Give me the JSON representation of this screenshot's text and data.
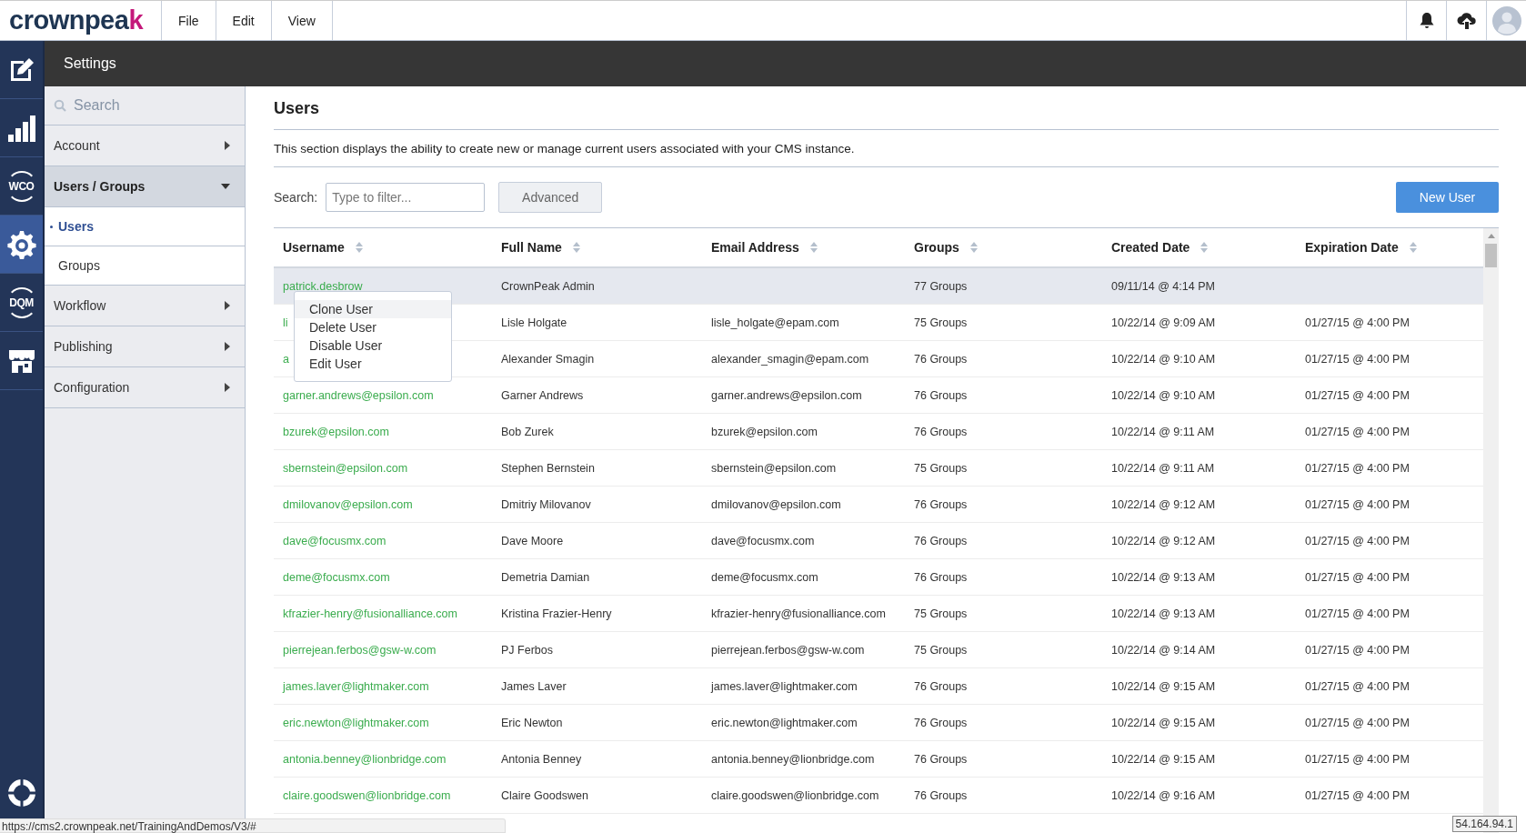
{
  "app": {
    "logo": "crownpea",
    "logo_accent": "k",
    "menu": [
      "File",
      "Edit",
      "View"
    ]
  },
  "rail": [
    {
      "kind": "edit",
      "selected": false
    },
    {
      "kind": "chart",
      "selected": false
    },
    {
      "kind": "badge",
      "label": "WCO",
      "selected": false
    },
    {
      "kind": "settings",
      "selected": true
    },
    {
      "kind": "badge",
      "label": "DQM",
      "selected": false
    },
    {
      "kind": "store",
      "selected": false
    },
    {
      "kind": "help",
      "selected": false
    }
  ],
  "header": {
    "title": "Settings"
  },
  "nav": {
    "search_placeholder": "Search",
    "items": [
      {
        "label": "Account",
        "expanded": false
      },
      {
        "label": "Users / Groups",
        "expanded": true,
        "children": [
          {
            "label": "Users",
            "selected": true
          },
          {
            "label": "Groups",
            "selected": false
          }
        ]
      },
      {
        "label": "Workflow",
        "expanded": false
      },
      {
        "label": "Publishing",
        "expanded": false
      },
      {
        "label": "Configuration",
        "expanded": false
      }
    ]
  },
  "content": {
    "title": "Users",
    "description": "This section displays the ability to create new or manage current users associated with your CMS instance.",
    "search_label": "Search:",
    "search_placeholder": "Type to filter...",
    "advanced_button": "Advanced",
    "new_button": "New User"
  },
  "table": {
    "columns": [
      "Username",
      "Full Name",
      "Email Address",
      "Groups",
      "Created Date",
      "Expiration Date"
    ],
    "rows": [
      {
        "selected": true,
        "cells": [
          "patrick.desbrow",
          "CrownPeak Admin",
          "",
          "77 Groups",
          "09/11/14 @ 4:14 PM",
          ""
        ]
      },
      {
        "selected": false,
        "cells": [
          "li",
          "Lisle Holgate",
          "lisle_holgate@epam.com",
          "75 Groups",
          "10/22/14 @ 9:09 AM",
          "01/27/15 @ 4:00 PM"
        ]
      },
      {
        "selected": false,
        "cells": [
          "a",
          "Alexander Smagin",
          "alexander_smagin@epam.com",
          "76 Groups",
          "10/22/14 @ 9:10 AM",
          "01/27/15 @ 4:00 PM"
        ]
      },
      {
        "selected": false,
        "cells": [
          "garner.andrews@epsilon.com",
          "Garner Andrews",
          "garner.andrews@epsilon.com",
          "76 Groups",
          "10/22/14 @ 9:10 AM",
          "01/27/15 @ 4:00 PM"
        ]
      },
      {
        "selected": false,
        "cells": [
          "bzurek@epsilon.com",
          "Bob Zurek",
          "bzurek@epsilon.com",
          "76 Groups",
          "10/22/14 @ 9:11 AM",
          "01/27/15 @ 4:00 PM"
        ]
      },
      {
        "selected": false,
        "cells": [
          "sbernstein@epsilon.com",
          "Stephen Bernstein",
          "sbernstein@epsilon.com",
          "75 Groups",
          "10/22/14 @ 9:11 AM",
          "01/27/15 @ 4:00 PM"
        ]
      },
      {
        "selected": false,
        "cells": [
          "dmilovanov@epsilon.com",
          "Dmitriy Milovanov",
          "dmilovanov@epsilon.com",
          "76 Groups",
          "10/22/14 @ 9:12 AM",
          "01/27/15 @ 4:00 PM"
        ]
      },
      {
        "selected": false,
        "cells": [
          "dave@focusmx.com",
          "Dave Moore",
          "dave@focusmx.com",
          "76 Groups",
          "10/22/14 @ 9:12 AM",
          "01/27/15 @ 4:00 PM"
        ]
      },
      {
        "selected": false,
        "cells": [
          "deme@focusmx.com",
          "Demetria Damian",
          "deme@focusmx.com",
          "76 Groups",
          "10/22/14 @ 9:13 AM",
          "01/27/15 @ 4:00 PM"
        ]
      },
      {
        "selected": false,
        "cells": [
          "kfrazier-henry@fusionalliance.com",
          "Kristina Frazier-Henry",
          "kfrazier-henry@fusionalliance.com",
          "75 Groups",
          "10/22/14 @ 9:13 AM",
          "01/27/15 @ 4:00 PM"
        ]
      },
      {
        "selected": false,
        "cells": [
          "pierrejean.ferbos@gsw-w.com",
          "PJ Ferbos",
          "pierrejean.ferbos@gsw-w.com",
          "75 Groups",
          "10/22/14 @ 9:14 AM",
          "01/27/15 @ 4:00 PM"
        ]
      },
      {
        "selected": false,
        "cells": [
          "james.laver@lightmaker.com",
          "James Laver",
          "james.laver@lightmaker.com",
          "76 Groups",
          "10/22/14 @ 9:15 AM",
          "01/27/15 @ 4:00 PM"
        ]
      },
      {
        "selected": false,
        "cells": [
          "eric.newton@lightmaker.com",
          "Eric Newton",
          "eric.newton@lightmaker.com",
          "76 Groups",
          "10/22/14 @ 9:15 AM",
          "01/27/15 @ 4:00 PM"
        ]
      },
      {
        "selected": false,
        "cells": [
          "antonia.benney@lionbridge.com",
          "Antonia Benney",
          "antonia.benney@lionbridge.com",
          "76 Groups",
          "10/22/14 @ 9:15 AM",
          "01/27/15 @ 4:00 PM"
        ]
      },
      {
        "selected": false,
        "cells": [
          "claire.goodswen@lionbridge.com",
          "Claire Goodswen",
          "claire.goodswen@lionbridge.com",
          "76 Groups",
          "10/22/14 @ 9:16 AM",
          "01/27/15 @ 4:00 PM"
        ]
      }
    ]
  },
  "context_menu": [
    {
      "label": "Clone User",
      "selected": true
    },
    {
      "label": "Delete User",
      "selected": false
    },
    {
      "label": "Disable User",
      "selected": false
    },
    {
      "label": "Edit User",
      "selected": false
    }
  ],
  "status_bar": {
    "url": "https://cms2.crownpeak.net/TrainingAndDemos/V3/#",
    "ip": "54.164.94.1"
  }
}
